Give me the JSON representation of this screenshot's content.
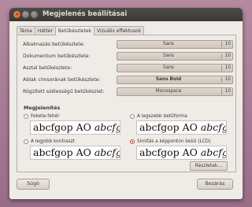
{
  "window": {
    "title": "Megjelenés beállításai"
  },
  "tabs": [
    {
      "label": "Téma"
    },
    {
      "label": "Háttér"
    },
    {
      "label": "Betűkészletek"
    },
    {
      "label": "Vizuális effektusok"
    }
  ],
  "fonts": [
    {
      "label": "Alkalmazás betűkészlete:",
      "font": "Sans",
      "size": "10"
    },
    {
      "label": "Dokumentum betűkészlete:",
      "font": "Sans",
      "size": "10"
    },
    {
      "label": "Asztal betűkészlete:",
      "font": "Sans",
      "size": "10"
    },
    {
      "label": "Ablak címsorának betűkészlete:",
      "font": "Sans Bold",
      "size": "10"
    },
    {
      "label": "Rögzített szélességű betűkészlet:",
      "font": "Monospace",
      "size": "10"
    }
  ],
  "rendering": {
    "title": "Megjelenítés",
    "options": [
      {
        "label": "Fekete-fehér",
        "selected": false
      },
      {
        "label": "A legszebb betűforma",
        "selected": false
      },
      {
        "label": "A legjobb kontraszt",
        "selected": false
      },
      {
        "label": "Simítás a képponton belül (LCD)",
        "selected": true
      }
    ],
    "sample_regular": "abcfgop AO ",
    "sample_italic": "abcfgop"
  },
  "buttons": {
    "details": "Részletek…",
    "help": "Súgó",
    "close": "Bezárás"
  }
}
